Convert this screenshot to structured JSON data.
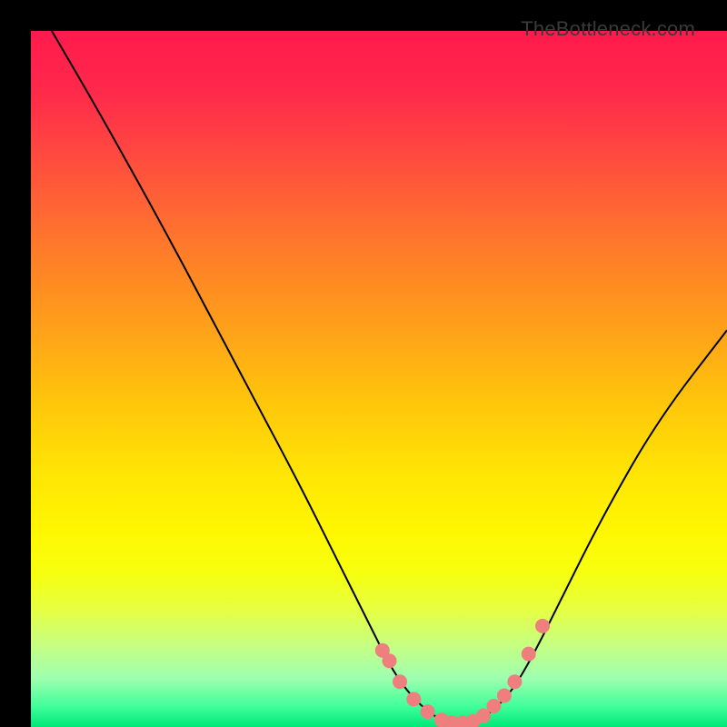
{
  "brand": "TheBottleneck.com",
  "chart_data": {
    "type": "line",
    "title": "",
    "xlabel": "",
    "ylabel": "",
    "xlim": [
      0,
      100
    ],
    "ylim": [
      0,
      100
    ],
    "grid": false,
    "legend": false,
    "series": [
      {
        "name": "bottleneck-curve",
        "x": [
          3,
          10,
          20,
          30,
          38,
          44,
          49,
          52,
          55,
          58,
          60,
          62,
          64,
          66,
          69,
          72,
          76,
          82,
          90,
          100
        ],
        "y": [
          100,
          88,
          70,
          51,
          36,
          24,
          14,
          8,
          4,
          1.5,
          0.5,
          0.5,
          0.8,
          2,
          5,
          10,
          18,
          30,
          44,
          57
        ]
      }
    ],
    "markers": {
      "name": "highlight-dots",
      "x": [
        50.5,
        51.5,
        53,
        55,
        57,
        59,
        60.5,
        62,
        63.5,
        65,
        66.5,
        68,
        69.5,
        71.5,
        73.5
      ],
      "y": [
        11,
        9.5,
        6.5,
        4,
        2.2,
        1,
        0.6,
        0.6,
        0.8,
        1.6,
        3,
        4.5,
        6.5,
        10.5,
        14.5
      ]
    },
    "background_gradient": {
      "top": "#ff1a4d",
      "mid": "#ffe605",
      "bottom": "#00e878"
    }
  }
}
